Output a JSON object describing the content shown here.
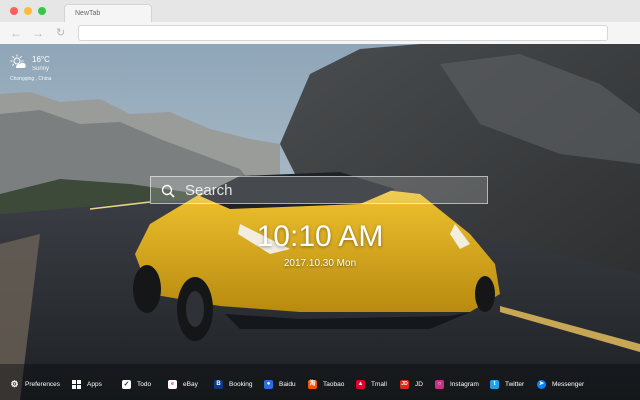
{
  "browser": {
    "tab_title": "NewTab"
  },
  "weather": {
    "temperature": "16°C",
    "condition": "Sunny",
    "location": "Chongqing , China"
  },
  "search": {
    "placeholder": "Search"
  },
  "clock": {
    "time": "10:10 AM",
    "date": "2017.10.30 Mon"
  },
  "bottom_bar": {
    "items": [
      {
        "label": "Preferences",
        "icon": "gear-icon",
        "color": "#ffffff"
      },
      {
        "label": "Apps",
        "icon": "grid-icon",
        "color": "#ffffff"
      },
      {
        "label": "Todo",
        "icon": "checkbox-icon",
        "color": "#ffffff"
      },
      {
        "label": "eBay",
        "icon": "ebay-icon",
        "color": "#ffffff"
      },
      {
        "label": "Booking",
        "icon": "booking-icon",
        "color": "#0b3a8a"
      },
      {
        "label": "Baidu",
        "icon": "baidu-icon",
        "color": "#2b6de5"
      },
      {
        "label": "Taobao",
        "icon": "taobao-icon",
        "color": "#ff5000"
      },
      {
        "label": "Tmall",
        "icon": "tmall-icon",
        "color": "#e4002b"
      },
      {
        "label": "JD",
        "icon": "jd-icon",
        "color": "#e1251b"
      },
      {
        "label": "Instagram",
        "icon": "instagram-icon",
        "color": "#c13584"
      },
      {
        "label": "Twitter",
        "icon": "twitter-icon",
        "color": "#1da1f2"
      },
      {
        "label": "Messenger",
        "icon": "messenger-icon",
        "color": "#0084ff"
      }
    ]
  }
}
